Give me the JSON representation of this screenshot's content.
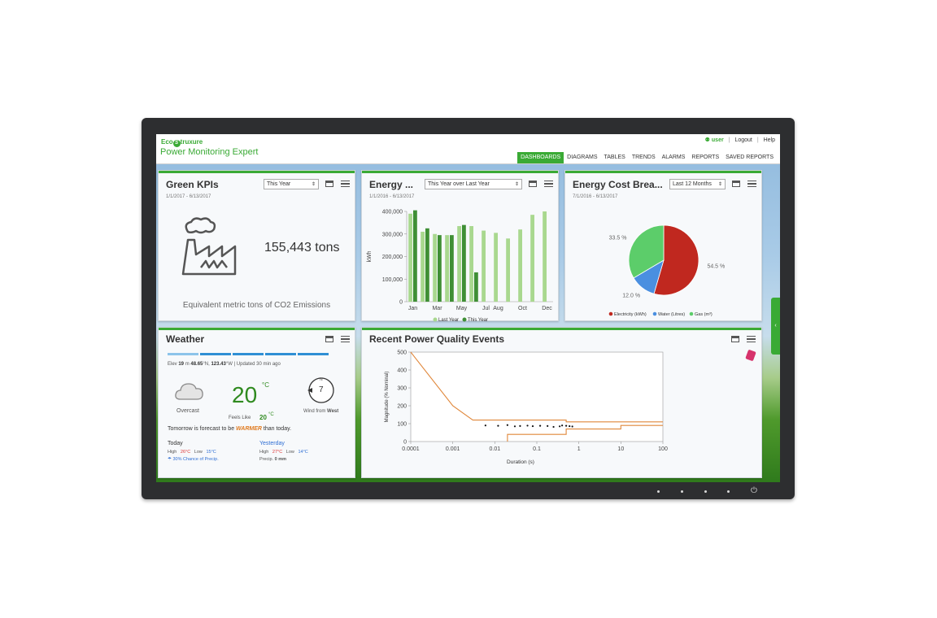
{
  "header": {
    "logo_eco": "Eco",
    "logo_rest": "truxure",
    "app_name": "Power Monitoring Expert",
    "user": "user",
    "logout": "Logout",
    "help": "Help",
    "nav": [
      "DASHBOARDS",
      "DIAGRAMS",
      "TABLES",
      "TRENDS",
      "ALARMS",
      "REPORTS",
      "SAVED REPORTS"
    ]
  },
  "kpi": {
    "title": "Green KPIs",
    "dropdown": "This Year",
    "date": "1/1/2017 - 6/13/2017",
    "value": "155,443 tons",
    "caption": "Equivalent metric tons of CO2 Emissions"
  },
  "energy": {
    "title": "Energy ...",
    "dropdown": "This Year over Last Year",
    "date": "1/1/2016 - 6/13/2017"
  },
  "cost": {
    "title": "Energy Cost Brea...",
    "dropdown": "Last 12 Months",
    "date": "7/1/2016 - 6/13/2017"
  },
  "weather": {
    "title": "Weather",
    "elev_label": "Elev",
    "elev_value": "19",
    "elev_unit": "m",
    "lat": "48.65",
    "lat_dir": "°N,",
    "lon": "123.43",
    "lon_dir": "°W",
    "updated": "Updated",
    "updated_ago": "30 min ago",
    "condition": "Overcast",
    "temp": "20",
    "temp_unit": "°C",
    "feels_label": "Feels Like",
    "feels_value": "20",
    "feels_unit": "°C",
    "wind_speed": "7",
    "wind_dir_label": "N",
    "wind_label": "Wind from",
    "wind_dir": "West",
    "forecast_pre": "Tomorrow is forecast to be",
    "forecast_word": "WARMER",
    "forecast_post": "than today.",
    "today": {
      "label": "Today",
      "high_label": "High",
      "high": "26",
      "high_unit": "°C",
      "low_label": "Low",
      "low": "15",
      "low_unit": "°C",
      "precip": "30% Chance of Precip."
    },
    "yesterday": {
      "label": "Yesterday",
      "high_label": "High",
      "high": "27",
      "high_unit": "°C",
      "low_label": "Low",
      "low": "14",
      "low_unit": "°C",
      "precip_label": "Precip.",
      "precip": "0 mm"
    }
  },
  "pq": {
    "title": "Recent Power Quality Events"
  },
  "colors": {
    "brand": "#3aaa35",
    "bar_last_year": "#a9d88f",
    "bar_this_year": "#3f8f35",
    "pie_electricity": "#c0281f",
    "pie_water": "#4a8fe0",
    "pie_gas": "#5ccd6a",
    "curve": "#e0873a"
  },
  "chart_data": [
    {
      "type": "bar",
      "ylabel": "kWh",
      "ylim": [
        0,
        400000
      ],
      "yticks": [
        "0",
        "100,000",
        "200,000",
        "300,000",
        "400,000"
      ],
      "xticks": [
        "Jan",
        "Mar",
        "May",
        "Jul",
        "Aug",
        "Oct",
        "Dec"
      ],
      "categories": [
        "Jan",
        "Feb",
        "Mar",
        "Apr",
        "May",
        "Jun",
        "Jul",
        "Aug",
        "Sep",
        "Oct",
        "Nov",
        "Dec"
      ],
      "series": [
        {
          "name": "Last Year",
          "values": [
            390000,
            310000,
            300000,
            295000,
            335000,
            335000,
            315000,
            305000,
            280000,
            320000,
            385000,
            400000
          ]
        },
        {
          "name": "This Year",
          "values": [
            405000,
            325000,
            295000,
            295000,
            340000,
            130000,
            null,
            null,
            null,
            null,
            null,
            null
          ]
        }
      ],
      "legend": "bottom"
    },
    {
      "type": "pie",
      "slices": [
        {
          "name": "Electricity (kWh)",
          "pct": 54.5,
          "label": "54.5 %"
        },
        {
          "name": "Water (Litres)",
          "pct": 12.0,
          "label": "12.0 %"
        },
        {
          "name": "Gas (m³)",
          "pct": 33.5,
          "label": "33.5 %"
        }
      ],
      "legend": "bottom"
    },
    {
      "type": "scatter",
      "xlabel": "Duration (s)",
      "ylabel": "Magnitude (% Nominal)",
      "xscale": "log",
      "xlim": [
        0.0001,
        100
      ],
      "ylim": [
        0,
        500
      ],
      "xticks": [
        "0.0001",
        "0.001",
        "0.01",
        "0.1",
        "1",
        "10",
        "100"
      ],
      "yticks": [
        "0",
        "100",
        "200",
        "300",
        "400",
        "500"
      ],
      "upper_curve": [
        [
          0.0001,
          500
        ],
        [
          0.001,
          200
        ],
        [
          0.003,
          120
        ],
        [
          0.5,
          120
        ],
        [
          0.5,
          110
        ],
        [
          100,
          110
        ]
      ],
      "lower_curve": [
        [
          0.02,
          0
        ],
        [
          0.02,
          40
        ],
        [
          0.5,
          40
        ],
        [
          0.5,
          70
        ],
        [
          10,
          70
        ],
        [
          10,
          90
        ],
        [
          100,
          90
        ]
      ],
      "points": [
        [
          0.006,
          90
        ],
        [
          0.012,
          88
        ],
        [
          0.02,
          92
        ],
        [
          0.03,
          85
        ],
        [
          0.04,
          87
        ],
        [
          0.06,
          89
        ],
        [
          0.08,
          86
        ],
        [
          0.12,
          88
        ],
        [
          0.18,
          87
        ],
        [
          0.25,
          82
        ],
        [
          0.35,
          85
        ],
        [
          0.4,
          90
        ],
        [
          0.5,
          88
        ],
        [
          0.6,
          86
        ],
        [
          0.7,
          84
        ]
      ]
    }
  ]
}
